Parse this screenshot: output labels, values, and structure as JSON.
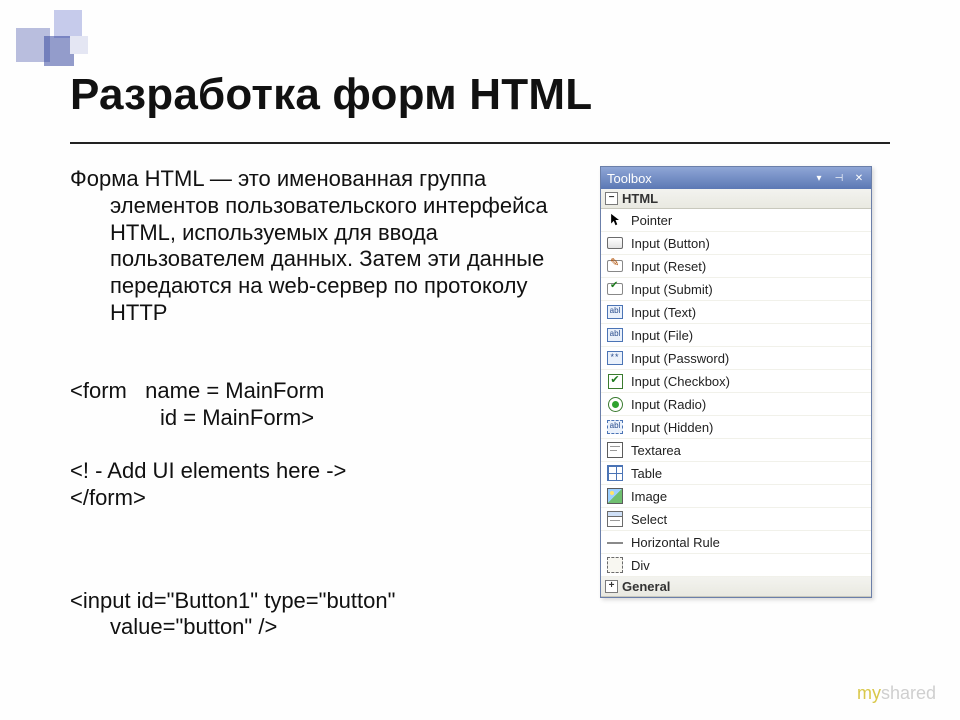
{
  "slide": {
    "title": "Разработка форм HTML",
    "paragraph": "Форма HTML — это именованная группа элементов пользовательского интерфейса HTML, используемых для ввода пользователем данных. Затем эти данные передаются на web-сервер по протоколу HTTP",
    "code1_line1": "<form   name = MainForm",
    "code1_line2": "id = MainForm>",
    "code1_line3": "<! - Add UI elements here ->",
    "code1_line4": "</form>",
    "code2_line1": "<input id=\"Button1\" type=\"button\"",
    "code2_line2": "value=\"button\" />"
  },
  "toolbox": {
    "title": "Toolbox",
    "section_html": "HTML",
    "section_general": "General",
    "items": [
      {
        "label": "Pointer",
        "icon": "pointer"
      },
      {
        "label": "Input (Button)",
        "icon": "button"
      },
      {
        "label": "Input (Reset)",
        "icon": "reset"
      },
      {
        "label": "Input (Submit)",
        "icon": "submit"
      },
      {
        "label": "Input (Text)",
        "icon": "text"
      },
      {
        "label": "Input (File)",
        "icon": "file"
      },
      {
        "label": "Input (Password)",
        "icon": "password"
      },
      {
        "label": "Input (Checkbox)",
        "icon": "checkbox"
      },
      {
        "label": "Input (Radio)",
        "icon": "radio"
      },
      {
        "label": "Input (Hidden)",
        "icon": "hidden"
      },
      {
        "label": "Textarea",
        "icon": "textarea"
      },
      {
        "label": "Table",
        "icon": "table"
      },
      {
        "label": "Image",
        "icon": "image"
      },
      {
        "label": "Select",
        "icon": "select"
      },
      {
        "label": "Horizontal Rule",
        "icon": "hr"
      },
      {
        "label": "Div",
        "icon": "div"
      }
    ]
  },
  "icon_text": {
    "text": "abl",
    "file": "abl",
    "hidden": "abl",
    "password": "**",
    "checkbox": "✔",
    "expander_minus": "−",
    "expander_plus": "+"
  },
  "watermark": {
    "my": "my",
    "shared": "shared"
  }
}
